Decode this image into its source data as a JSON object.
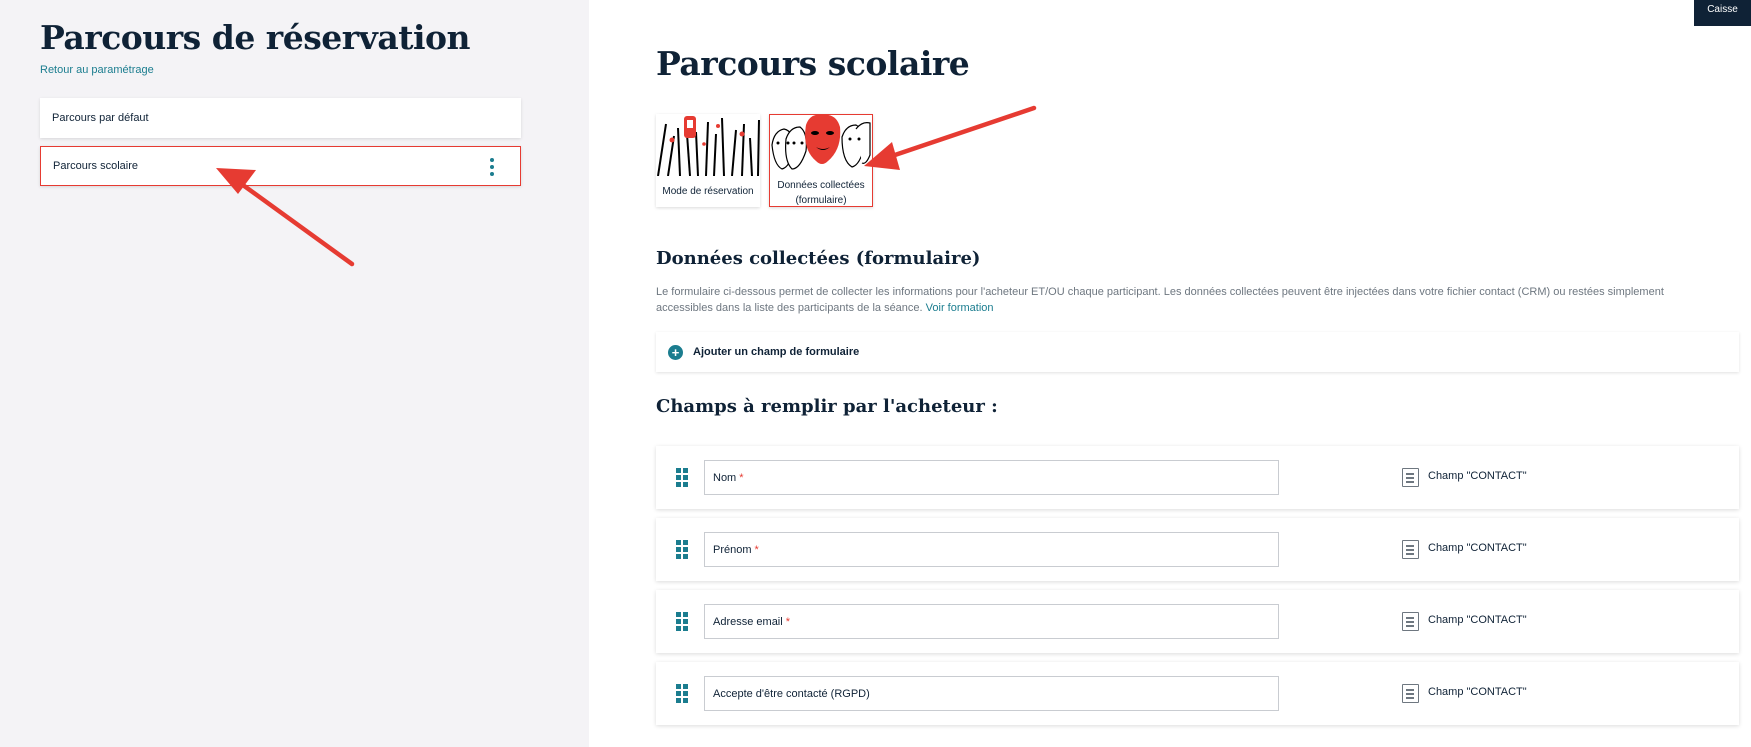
{
  "sidebar": {
    "title": "Parcours de réservation",
    "back_link": "Retour au paramétrage",
    "journeys": [
      {
        "label": "Parcours par défaut"
      },
      {
        "label": "Parcours scolaire"
      }
    ]
  },
  "topbar": {
    "caisse_label": "Caisse"
  },
  "main": {
    "title": "Parcours scolaire",
    "steps": [
      {
        "label": "Mode de réservation"
      },
      {
        "label": "Données collectées (formulaire)"
      }
    ],
    "collected_section": {
      "title": "Données collectées (formulaire)",
      "description": "Le formulaire ci-dessous permet de collecter les informations pour l'acheteur ET/OU chaque participant. Les données collectées peuvent être injectées dans votre fichier contact (CRM) ou restées simplement accessibles dans la liste des participants de la séance.",
      "training_link": "Voir formation",
      "add_field_label": "Ajouter un champ de formulaire"
    },
    "buyer_section": {
      "title": "Champs à remplir par l'acheteur :",
      "fields": [
        {
          "label": "Nom",
          "required": "*",
          "type": "Champ \"CONTACT\""
        },
        {
          "label": "Prénom",
          "required": "*",
          "type": "Champ \"CONTACT\""
        },
        {
          "label": "Adresse email",
          "required": "*",
          "type": "Champ \"CONTACT\""
        },
        {
          "label": "Accepte d'être contacté (RGPD)",
          "required": "",
          "type": "Champ \"CONTACT\""
        }
      ]
    }
  },
  "colors": {
    "accent": "#1b7d8f",
    "highlight": "#e63b32",
    "navy": "#0f2236"
  }
}
